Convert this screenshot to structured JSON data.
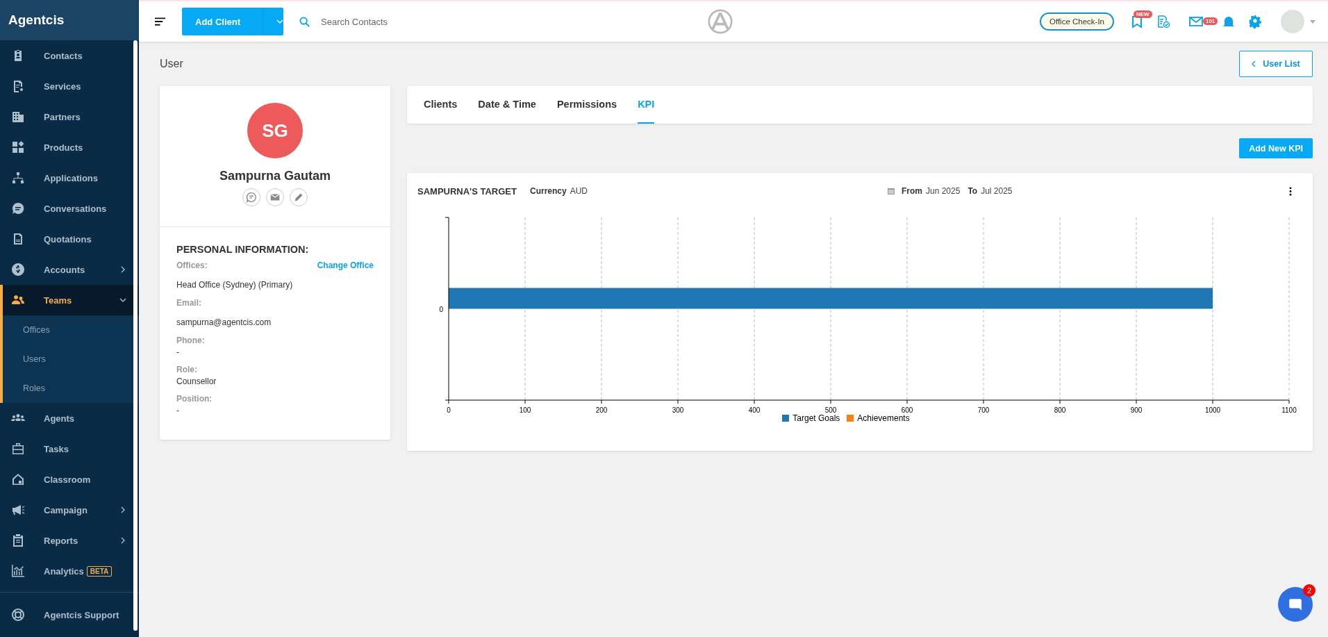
{
  "sidebar": {
    "brand": "Agentcis",
    "items": [
      {
        "label": "Contacts",
        "selected": false
      },
      {
        "label": "Services",
        "selected": false
      },
      {
        "label": "Partners",
        "selected": false
      },
      {
        "label": "Products",
        "selected": false
      },
      {
        "label": "Applications",
        "selected": false
      },
      {
        "label": "Conversations",
        "selected": false
      },
      {
        "label": "Quotations",
        "selected": false
      },
      {
        "label": "Accounts",
        "selected": false,
        "expanded": false
      },
      {
        "label": "Teams",
        "selected": true,
        "expanded": true,
        "children": [
          {
            "label": "Offices",
            "selected": false
          },
          {
            "label": "Users",
            "selected": false
          },
          {
            "label": "Roles",
            "selected": false
          }
        ]
      },
      {
        "label": "Agents",
        "selected": false
      },
      {
        "label": "Tasks",
        "selected": false
      },
      {
        "label": "Classroom",
        "selected": false
      },
      {
        "label": "Campaign",
        "selected": false,
        "expanded": false
      },
      {
        "label": "Reports",
        "selected": false,
        "expanded": false
      },
      {
        "label": "Analytics",
        "selected": false,
        "badge": "BETA"
      }
    ],
    "support": "Agentcis Support"
  },
  "topbar": {
    "add_button": "Add Client",
    "search": {
      "placeholder": "Search Contacts"
    },
    "check_in": "Office Check-In",
    "bookmark_badge": "NEW",
    "notification_badge": "101"
  },
  "page": {
    "title": "User",
    "back_button": "User List"
  },
  "profile": {
    "initials": "SG",
    "name": "Sampurna Gautam",
    "section_title": "PERSONAL INFORMATION:",
    "fields": [
      {
        "label": "Offices:",
        "value": "Head Office (Sydney) (Primary)",
        "action": "Change Office"
      },
      {
        "label": "Email:",
        "value": "sampurna@agentcis.com"
      },
      {
        "label": "Phone:",
        "value": "-"
      },
      {
        "label": "Role:",
        "value": "Counsellor"
      },
      {
        "label": "Position:",
        "value": "-"
      }
    ]
  },
  "tabs": [
    {
      "label": "Clients",
      "selected": false
    },
    {
      "label": "Date & Time",
      "selected": false
    },
    {
      "label": "Permissions",
      "selected": false
    },
    {
      "label": "KPI",
      "selected": true
    }
  ],
  "add_kpi": "Add New KPI",
  "kpi": {
    "title": "SAMPURNA'S TARGET",
    "currency_label": "Currency",
    "currency": "AUD",
    "from_label": "From",
    "from": "Jun 2025",
    "to_label": "To",
    "to": "Jul 2025",
    "chart_data": {
      "type": "bar",
      "orientation": "horizontal",
      "categories": [
        "0"
      ],
      "series": [
        {
          "name": "Target Goals",
          "color": "#1f77b4",
          "values": [
            1000
          ]
        },
        {
          "name": "Achievements",
          "color": "#ff7f0e",
          "values": [
            0
          ]
        }
      ],
      "xlim": [
        0,
        1100
      ],
      "xticks": [
        0,
        100,
        200,
        300,
        400,
        500,
        600,
        700,
        800,
        900,
        1000,
        1100
      ],
      "grid": true
    }
  },
  "chat": {
    "badge": "2"
  }
}
